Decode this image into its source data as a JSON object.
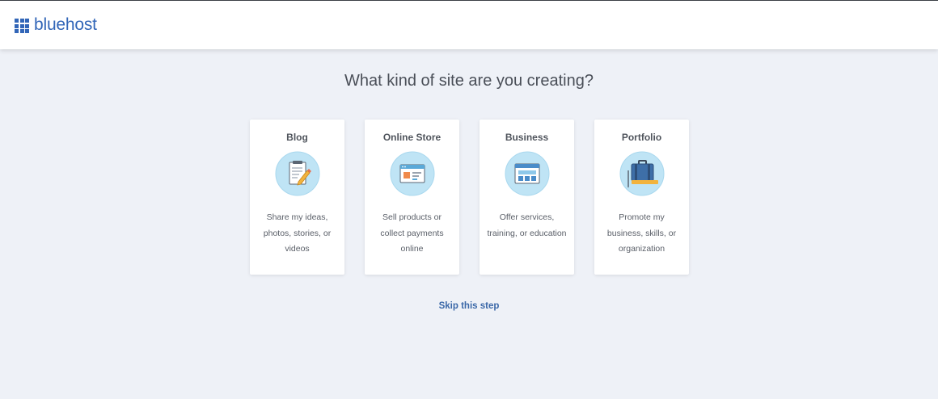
{
  "header": {
    "brand": "bluehost"
  },
  "main": {
    "title": "What kind of site are you creating?",
    "cards": [
      {
        "title": "Blog",
        "icon": "blog-notepad-icon",
        "description": "Share my ideas, photos, stories, or videos"
      },
      {
        "title": "Online Store",
        "icon": "online-store-icon",
        "description": "Sell products or collect payments online"
      },
      {
        "title": "Business",
        "icon": "business-website-icon",
        "description": "Offer services, training, or education"
      },
      {
        "title": "Portfolio",
        "icon": "portfolio-briefcase-icon",
        "description": "Promote my business, skills, or organization"
      }
    ],
    "skip_label": "Skip this step"
  },
  "colors": {
    "brand": "#3266b8",
    "background": "#eef1f7",
    "icon_circle": "#bfe4f5",
    "link": "#3b68a8"
  }
}
